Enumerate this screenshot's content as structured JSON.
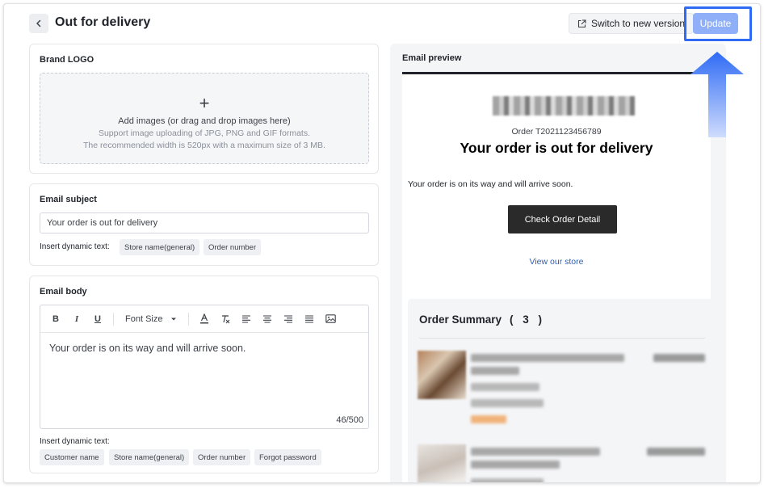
{
  "header": {
    "title": "Out for delivery",
    "switch_label": "Switch to new version",
    "update_label": "Update"
  },
  "brand_logo": {
    "title": "Brand LOGO",
    "upload_title": "Add images (or drag and drop images here)",
    "upload_hint_1": "Support image uploading of JPG, PNG and GIF formats.",
    "upload_hint_2": "The recommended width is 520px with a maximum size of 3 MB."
  },
  "email_subject": {
    "title": "Email subject",
    "value": "Your order is out for delivery",
    "dynamic_label": "Insert dynamic text:",
    "chips": [
      "Store name(general)",
      "Order number"
    ]
  },
  "email_body": {
    "title": "Email body",
    "toolbar": {
      "bold": "B",
      "italic": "I",
      "underline": "U",
      "font_size": "Font Size"
    },
    "content": "Your order is on its way and will arrive soon.",
    "counter": "46/500",
    "dynamic_label": "Insert dynamic text:",
    "chips": [
      "Customer name",
      "Store name(general)",
      "Order number",
      "Forgot password"
    ]
  },
  "preview": {
    "title": "Email preview",
    "order_number": "Order T2021123456789",
    "heading": "Your order is out for delivery",
    "body": "Your order is on its way and will arrive soon.",
    "cta": "Check Order Detail",
    "store_link": "View our store",
    "summary_title": "Order Summary",
    "summary_count": "( 3 )"
  },
  "colors": {
    "accent": "#2f6bf5",
    "update_button": "#8fb0f8",
    "cta": "#2a2a2a",
    "link": "#2f5fb3"
  }
}
